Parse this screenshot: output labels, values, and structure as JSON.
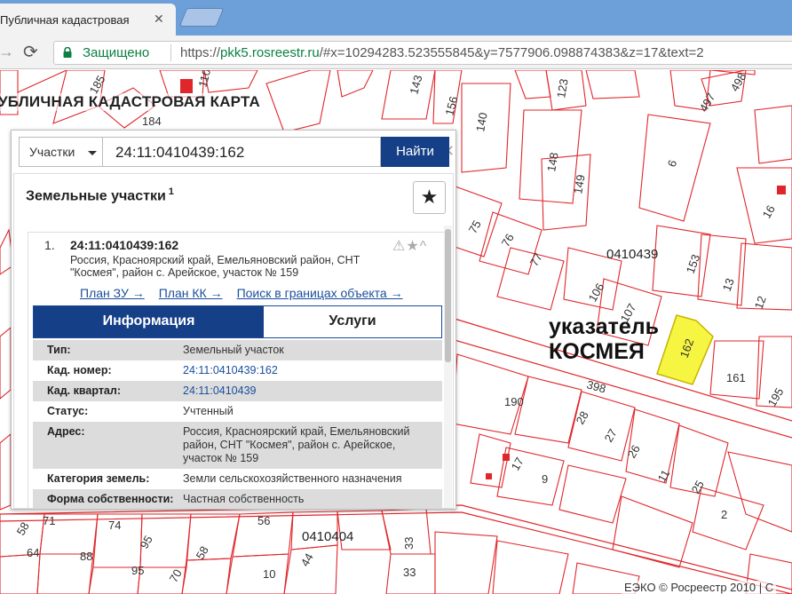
{
  "browser": {
    "tab_title": "Публичная кадастровая",
    "tab_close": "✕",
    "back_glyph": "→",
    "reload_glyph": "⟳",
    "secure_label": "Защищено",
    "url_scheme": "https://",
    "url_host": "pkk5.rosreestr.ru",
    "url_rest": "/#x=10294283.523555845&y=7577906.098874383&z=17&text=2"
  },
  "map": {
    "title": "УБЛИЧНАЯ КАДАСТРОВАЯ КАРТА",
    "annotation_line1": "указатель",
    "annotation_line2": "КОСМЕЯ",
    "copyright": "ЕЭКО © Росреестр 2010 | С",
    "highlight_color": "#f5f542",
    "parcel_line_color": "#e0262b",
    "quarter_labels": [
      "0410439",
      "0410404"
    ],
    "parcel_numbers": [
      "185",
      "110",
      "184",
      "143",
      "156",
      "123",
      "140",
      "148",
      "149",
      "6",
      "498",
      "497",
      "16",
      "75",
      "76",
      "77",
      "106",
      "107",
      "153",
      "13",
      "12",
      "162",
      "161",
      "195",
      "190",
      "28",
      "27",
      "26",
      "11",
      "25",
      "17",
      "9",
      "2",
      "398",
      "74",
      "95",
      "58",
      "64",
      "88",
      "95",
      "56",
      "44",
      "33",
      "71",
      "58",
      "10",
      "33",
      "70"
    ]
  },
  "search": {
    "type_label": "Участки",
    "query": "24:11:0410439:162",
    "clear_glyph": "✕",
    "find_label": "Найти"
  },
  "results": {
    "heading": "Земельные участки",
    "count": "1",
    "star_glyph": "★",
    "item": {
      "index": "1.",
      "title": "24:11:0410439:162",
      "address": "Россия, Красноярский край, Емельяновский район, СНТ \"Космея\", район с. Арейское, участок № 159",
      "icons": "⚠★^",
      "links": [
        "План ЗУ →",
        "План КК →",
        "Поиск в границах объекта →"
      ],
      "tabs": [
        "Информация",
        "Услуги"
      ],
      "attributes": [
        {
          "k": "Тип:",
          "v": "Земельный участок"
        },
        {
          "k": "Кад. номер:",
          "v": "24:11:0410439:162"
        },
        {
          "k": "Кад. квартал:",
          "v": "24:11:0410439"
        },
        {
          "k": "Статус:",
          "v": "Учтенный"
        },
        {
          "k": "Адрес:",
          "v": "Россия, Красноярский край, Емельяновский район, СНТ \"Космея\", район с. Арейское, участок № 159"
        },
        {
          "k": "Категория земель:",
          "v": "Земли сельскохозяйственного назначения"
        },
        {
          "k": "Форма собственности:",
          "v": "Частная собственность"
        }
      ]
    }
  }
}
